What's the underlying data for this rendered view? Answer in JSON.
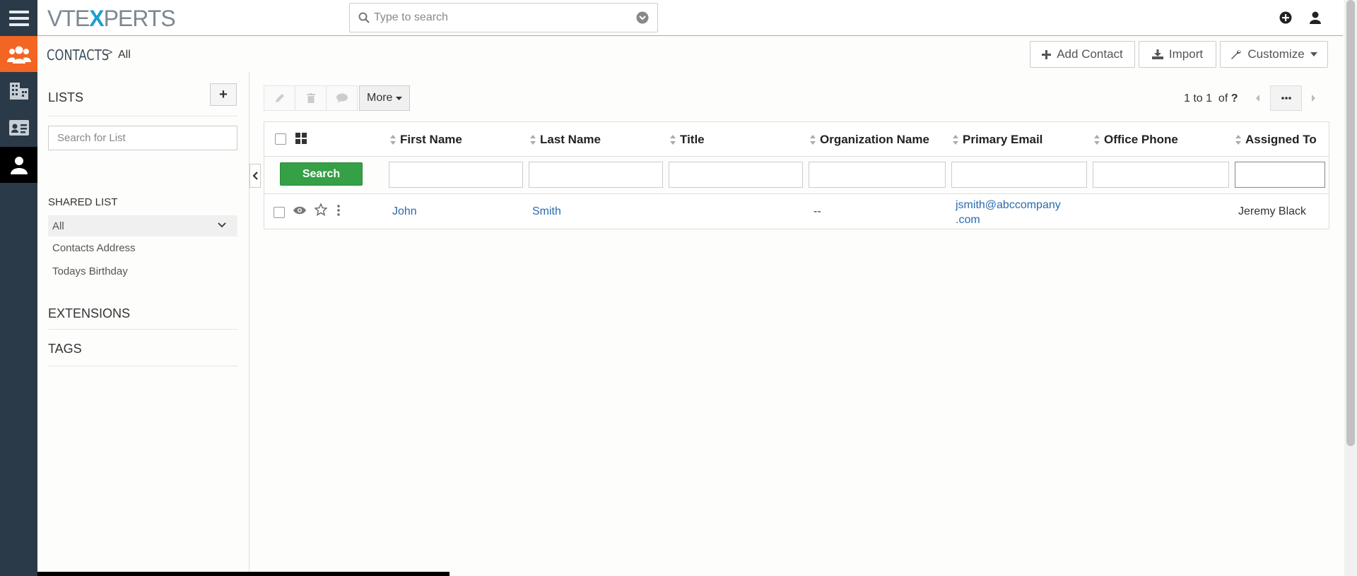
{
  "app": {
    "logo_left": "VTE",
    "logo_x": "X",
    "logo_right": "PERTS"
  },
  "rail": {
    "items": [
      "menu-icon",
      "contacts-group-icon",
      "organizations-icon",
      "id-card-icon",
      "contact-icon"
    ]
  },
  "global_search": {
    "placeholder": "Type to search"
  },
  "breadcrumb": {
    "module": "CONTACTS",
    "separator": ">",
    "view": "All"
  },
  "header_buttons": {
    "add": "Add Contact",
    "import": "Import",
    "customize": "Customize"
  },
  "sidebar": {
    "lists_title": "LISTS",
    "add_label": "+",
    "search_placeholder": "Search for List",
    "shared_title": "SHARED LIST",
    "items": [
      {
        "label": "All"
      },
      {
        "label": "Contacts Address"
      },
      {
        "label": "Todays Birthday"
      }
    ],
    "extensions_title": "EXTENSIONS",
    "tags_title": "TAGS"
  },
  "toolbar": {
    "more_label": "More"
  },
  "paging": {
    "range": "1 to 1",
    "of": "of",
    "total": "?"
  },
  "grid": {
    "search_button": "Search",
    "columns": [
      "First Name",
      "Last Name",
      "Title",
      "Organization Name",
      "Primary Email",
      "Office Phone",
      "Assigned To"
    ],
    "rows": [
      {
        "first_name": "John",
        "last_name": "Smith",
        "title": "",
        "organization": "--",
        "email_line1": "jsmith@abccompany",
        "email_line2": ".com",
        "office_phone": "",
        "assigned_to": "Jeremy Black"
      }
    ]
  },
  "colors": {
    "rail": "#2b3a48",
    "accent_orange": "#f26522",
    "search_green": "#35a046",
    "link_blue": "#2a6bad"
  }
}
